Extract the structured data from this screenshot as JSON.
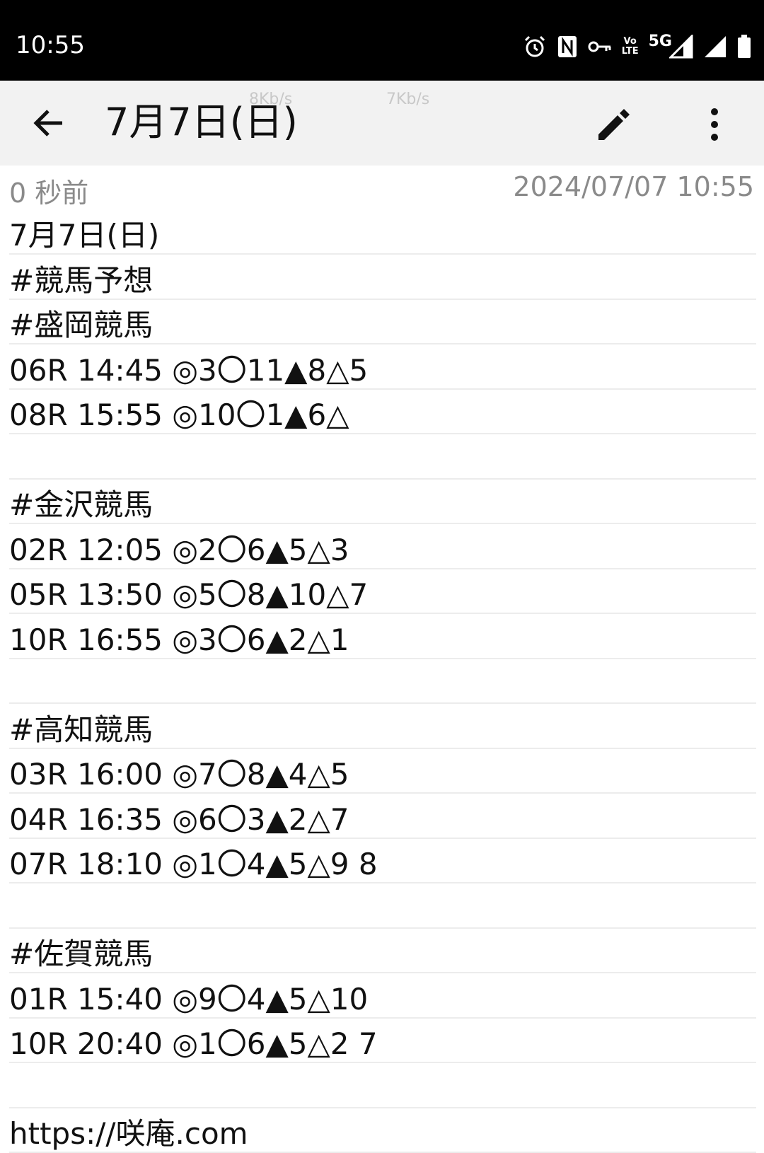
{
  "status_bar": {
    "time": "10:55",
    "icons": [
      "alarm-icon",
      "nfc-icon",
      "vpn-key-icon",
      "volte-icon",
      "5g-signal-icon",
      "signal-icon",
      "battery-icon"
    ],
    "volte_top": "Vo",
    "volte_bottom": "LTE",
    "network": "5G"
  },
  "app_bar": {
    "title": "7月7日(日)",
    "speed_left": "8Kb/s",
    "speed_right": "7Kb/s",
    "icons": [
      "back-arrow-icon",
      "edit-pencil-icon",
      "more-vert-icon"
    ]
  },
  "meta": {
    "relative_time": "0 秒前",
    "timestamp": "2024/07/07 10:55"
  },
  "note": {
    "lines": [
      "7月7日(日)",
      "#競馬予想",
      "#盛岡競馬",
      "06R 14:45 ◎3〇11▲8△5",
      "08R 15:55 ◎10〇1▲6△",
      "",
      "#金沢競馬",
      "02R 12:05 ◎2〇6▲5△3",
      "05R 13:50 ◎5〇8▲10△7",
      "10R 16:55 ◎3〇6▲2△1",
      "",
      "#高知競馬",
      "03R 16:00 ◎7〇8▲4△5",
      "04R 16:35 ◎6〇3▲2△7",
      "07R 18:10 ◎1〇4▲5△9 8",
      "",
      "#佐賀競馬",
      "01R 15:40 ◎9〇4▲5△10",
      "10R 20:40 ◎1〇6▲5△2 7",
      "",
      "https://咲庵.com"
    ]
  }
}
